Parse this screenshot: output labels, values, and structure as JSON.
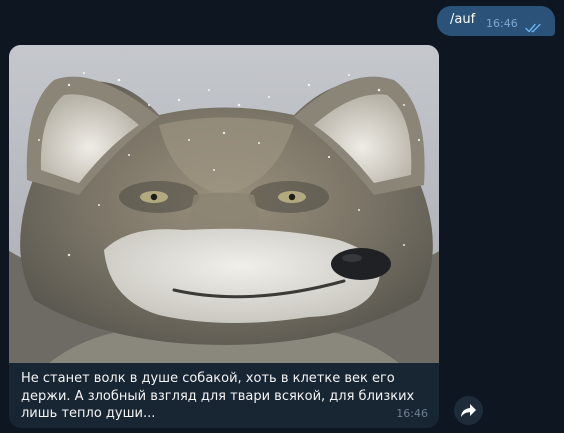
{
  "outgoing_message": {
    "text": "/auf",
    "time": "16:46",
    "status_icon": "double-check-icon"
  },
  "incoming_message": {
    "photo_icon": "wolf-photo",
    "caption": "Не станет волк в душе собакой, хоть в клетке век его держи. А злобный взгляд для твари всякой, для близких лишь тепло души...",
    "time": "16:46"
  },
  "forward_button": {
    "icon": "share-arrow-icon"
  },
  "colors": {
    "background": "#0e1621",
    "outgoing_bubble": "#2b5278",
    "incoming_bubble": "#182533",
    "timestamp_out": "#7da8d3",
    "timestamp_in": "#6d7f8f"
  }
}
